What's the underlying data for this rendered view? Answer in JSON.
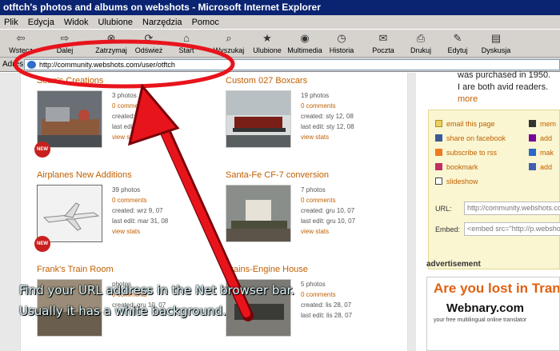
{
  "window": {
    "title": "otftch's photos and albums on webshots - Microsoft Internet Explorer"
  },
  "menu": [
    "Plik",
    "Edycja",
    "Widok",
    "Ulubione",
    "Narzędzia",
    "Pomoc"
  ],
  "toolbar": {
    "back": "Wstecz",
    "forward": "Dalej",
    "stop": "Zatrzymaj",
    "refresh": "Odśwież",
    "home": "Start",
    "search": "Wyszukaj",
    "favorites": "Ulubione",
    "multimedia": "Multimedia",
    "history": "Historia",
    "mail": "Poczta",
    "print": "Drukuj",
    "edit": "Edytuj",
    "discuss": "Dyskusja"
  },
  "address": {
    "label": "Adres",
    "url": "http://community.webshots.com/user/otftch"
  },
  "albums": [
    {
      "title": "Sean's Creations",
      "photos": "3 photos",
      "comments": "0 comments",
      "created": "created: lut 12, 08",
      "edited": "last edit: lut 15, 08",
      "stats": "view stats",
      "new": "NEW"
    },
    {
      "title": "Custom 027 Boxcars",
      "photos": "19 photos",
      "comments": "0 comments",
      "created": "created: sty 12, 08",
      "edited": "last edit: sty 12, 08",
      "stats": "view stats"
    },
    {
      "title": "Airplanes New Additions",
      "photos": "39 photos",
      "comments": "0 comments",
      "created": "created: wrz 9, 07",
      "edited": "last edit: mar 31, 08",
      "stats": "view stats",
      "new": "NEW"
    },
    {
      "title": "Santa-Fe CF-7 conversion",
      "photos": "7 photos",
      "comments": "0 comments",
      "created": "created: gru 10, 07",
      "edited": "last edit: gru 10, 07",
      "stats": "view stats"
    },
    {
      "title": "Frank's Train Room",
      "photos": "photos",
      "comments": "0 comments",
      "created": "created: gru 10, 07",
      "edited": "",
      "stats": ""
    },
    {
      "title": "Trains-Engine House",
      "photos": "5 photos",
      "comments": "0 comments",
      "created": "created: lis 28, 07",
      "edited": "last edit: lis 28, 07",
      "stats": ""
    }
  ],
  "about": {
    "line1": "was purchased in 1950.",
    "line2": "I are both avid readers.",
    "more": "more"
  },
  "share": {
    "email": "email this page",
    "facebook": "share on facebook",
    "rss": "subscribe to rss",
    "bookmark": "bookmark",
    "slideshow": "slideshow",
    "c2a": "mem",
    "c2b": "add",
    "c2c": "mak",
    "c2d": "add"
  },
  "url_field": {
    "label": "URL:",
    "value": "http://community.webshots.com"
  },
  "embed_field": {
    "label": "Embed:",
    "value": "<embed src=\"http://p.webshots"
  },
  "ad": {
    "header": "advertisement",
    "headline": "Are you lost in Tran",
    "brand": "Webnary.com",
    "tagline": "your free multilingual online translator"
  },
  "caption": {
    "line1": "Find your URL address in the Net browser bar.",
    "line2": "Usually it has a white background."
  },
  "colors": {
    "accent": "#c06000",
    "titlebar": "#0a2472",
    "annotation": "#e8141c"
  }
}
